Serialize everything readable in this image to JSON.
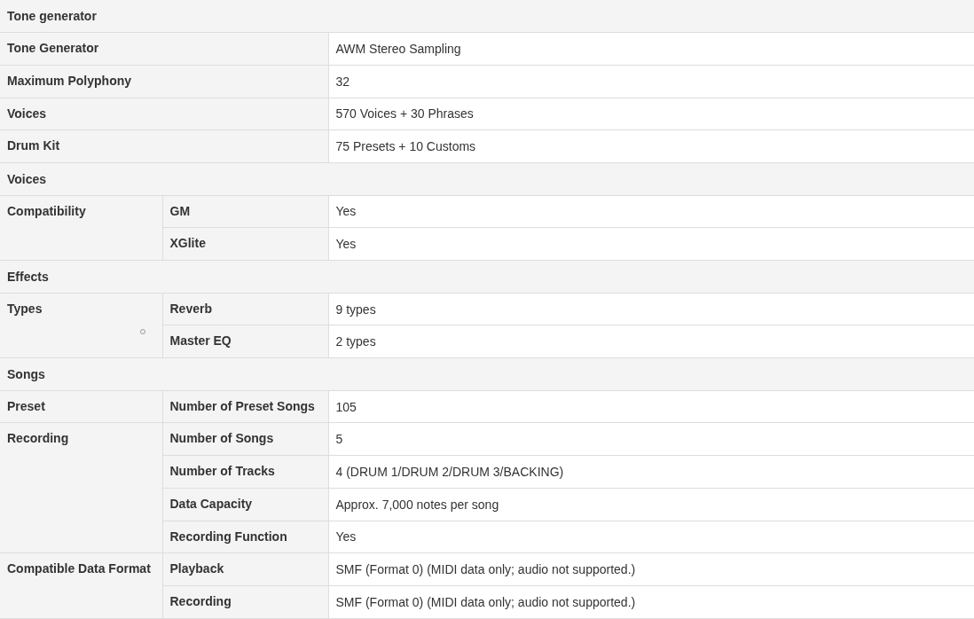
{
  "sections": [
    {
      "title": "Tone generator",
      "rows": [
        {
          "kind": "simple",
          "label": "Tone Generator",
          "value": "AWM Stereo Sampling"
        },
        {
          "kind": "simple",
          "label": "Maximum Polyphony",
          "value": "32"
        },
        {
          "kind": "simple",
          "label": "Voices",
          "value": "570 Voices + 30 Phrases"
        },
        {
          "kind": "simple",
          "label": "Drum Kit",
          "value": "75 Presets + 10 Customs"
        }
      ]
    },
    {
      "title": "Voices",
      "rows": [
        {
          "kind": "grouped",
          "label": "Compatibility",
          "items": [
            {
              "label": "GM",
              "value": "Yes"
            },
            {
              "label": "XGlite",
              "value": "Yes"
            }
          ]
        }
      ]
    },
    {
      "title": "Effects",
      "rows": [
        {
          "kind": "grouped",
          "label": "Types",
          "items": [
            {
              "label": "Reverb",
              "value": "9 types"
            },
            {
              "label": "Master EQ",
              "value": "2 types"
            }
          ]
        }
      ]
    },
    {
      "title": "Songs",
      "rows": [
        {
          "kind": "grouped",
          "label": "Preset",
          "items": [
            {
              "label": "Number of Preset Songs",
              "value": "105"
            }
          ]
        },
        {
          "kind": "grouped",
          "label": "Recording",
          "items": [
            {
              "label": "Number of Songs",
              "value": "5"
            },
            {
              "label": "Number of Tracks",
              "value": "4 (DRUM 1/DRUM 2/DRUM 3/BACKING)"
            },
            {
              "label": "Data Capacity",
              "value": "Approx. 7,000 notes per song"
            },
            {
              "label": "Recording Function",
              "value": "Yes"
            }
          ]
        },
        {
          "kind": "grouped",
          "label": "Compatible Data Format",
          "items": [
            {
              "label": "Playback",
              "value": "SMF (Format 0) (MIDI data only; audio not supported.)"
            },
            {
              "label": "Recording",
              "value": "SMF (Format 0) (MIDI data only; audio not supported.)"
            }
          ]
        }
      ]
    }
  ]
}
